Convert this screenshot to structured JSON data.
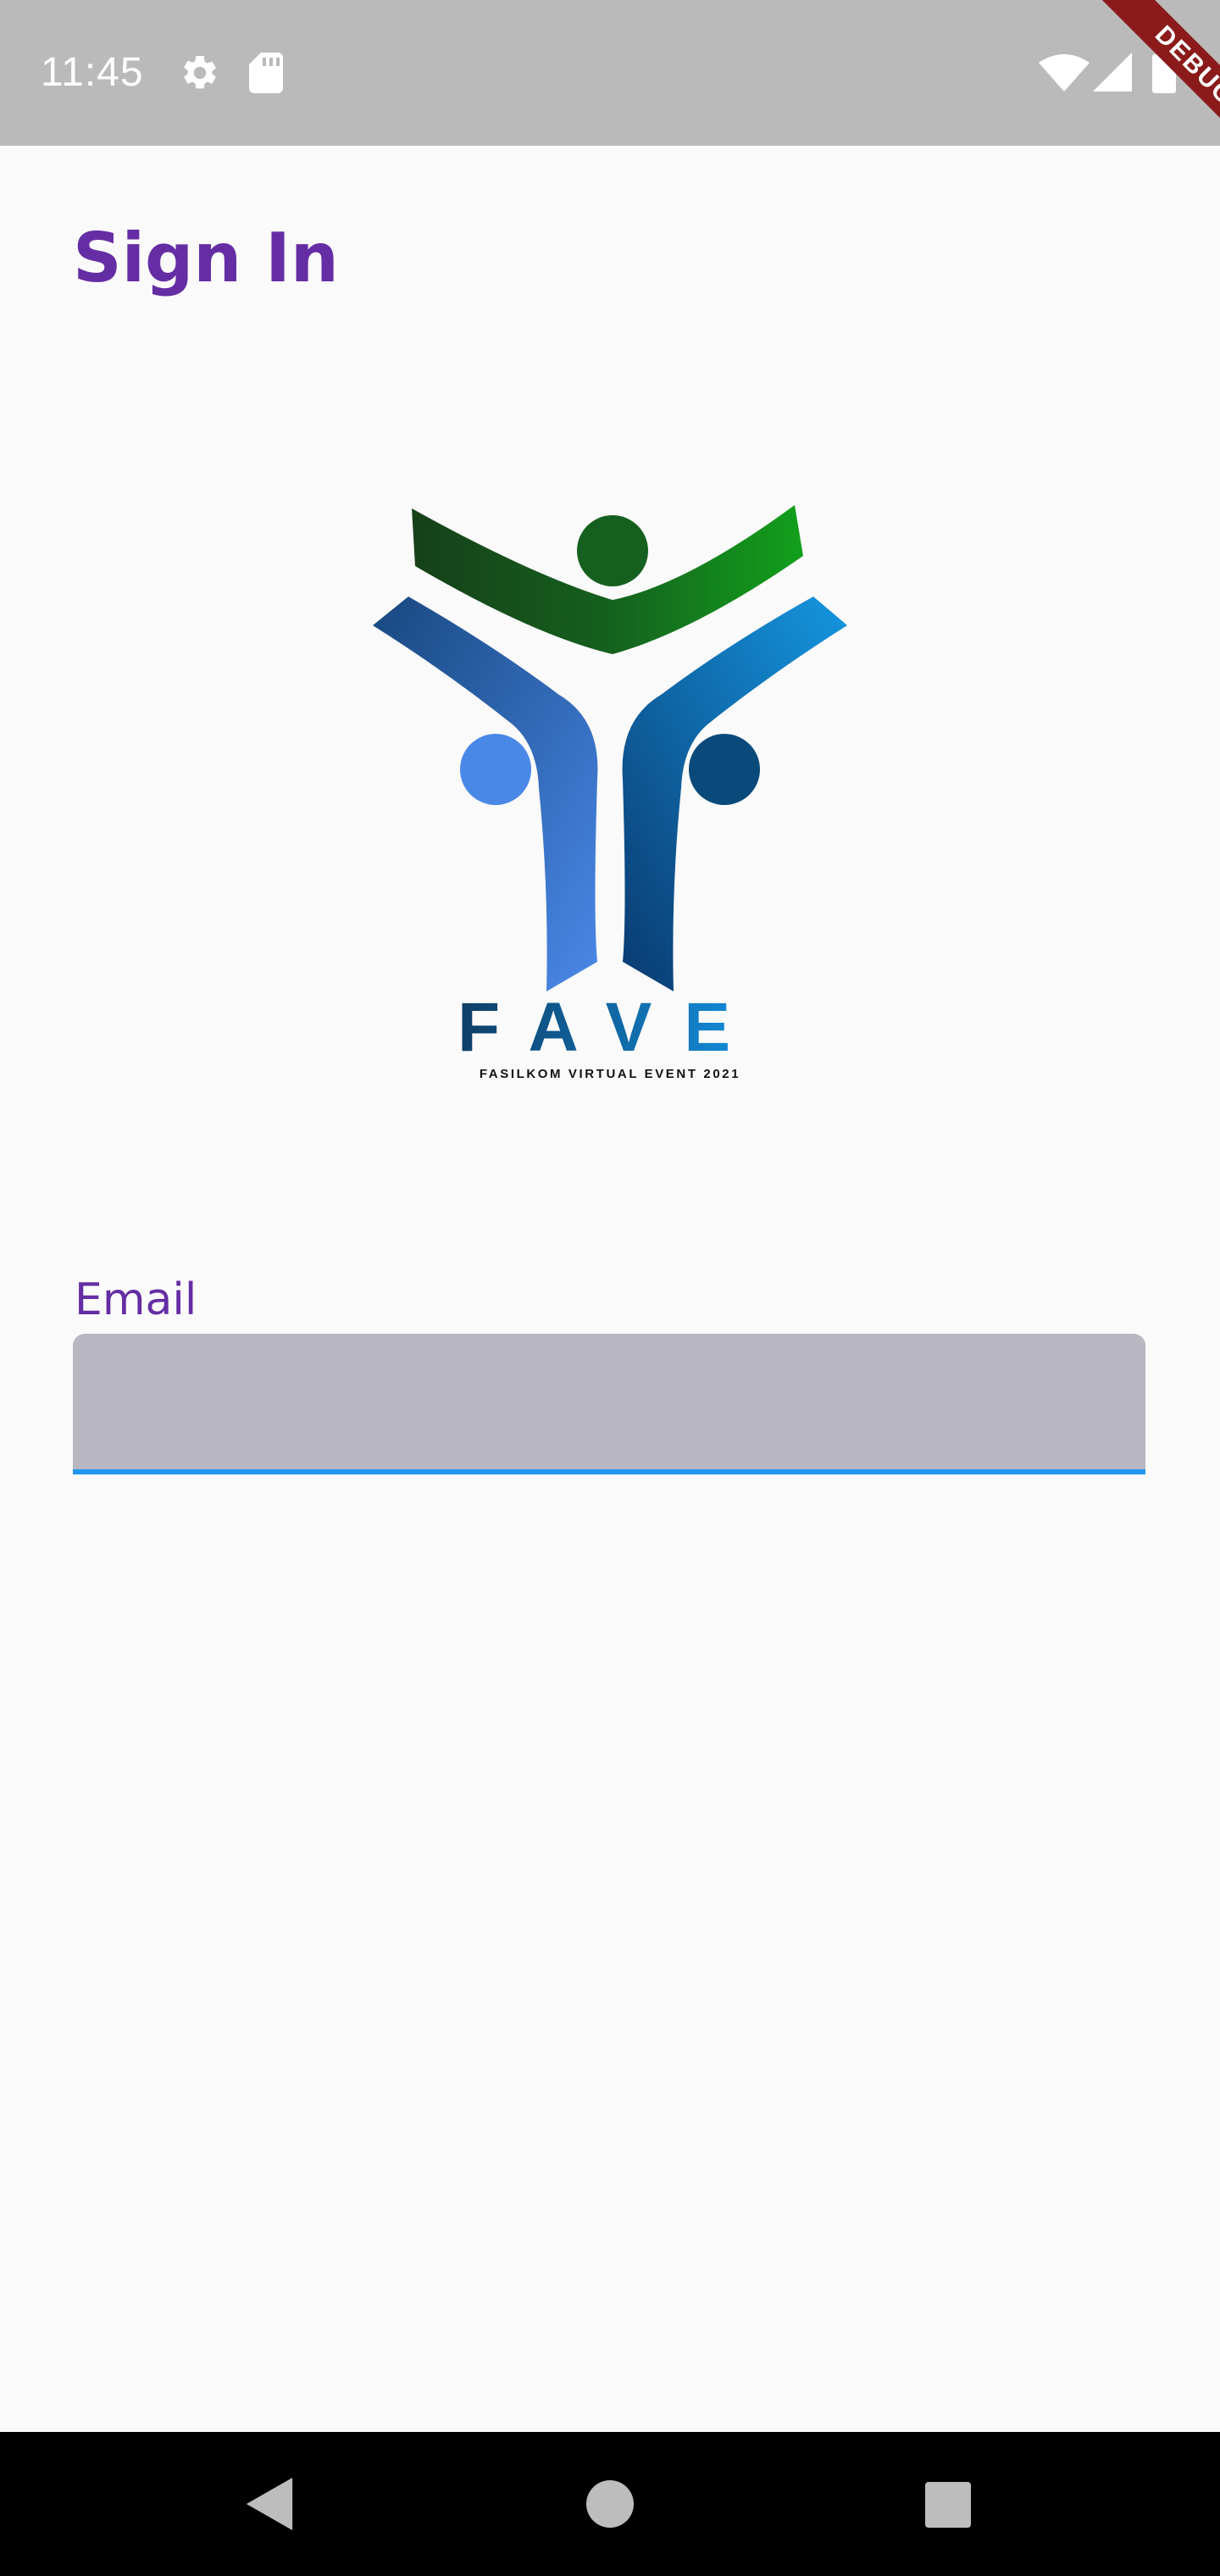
{
  "status_bar": {
    "time": "11:45",
    "icons": [
      "gear-icon",
      "sd-card-icon",
      "wifi-icon",
      "signal-icon",
      "battery-icon"
    ]
  },
  "debug_banner": {
    "label": "DEBUG"
  },
  "page": {
    "title": "Sign In"
  },
  "logo": {
    "name": "FAVE",
    "tagline": "FASILKOM VIRTUAL EVENT 2021"
  },
  "form": {
    "email_label": "Email",
    "email_value": "",
    "email_placeholder": ""
  },
  "nav_bar": {
    "icons": [
      "back-icon",
      "home-icon",
      "recents-icon"
    ]
  },
  "colors": {
    "accent": "#652DA4",
    "input_fill": "#B7B6C1",
    "input_underline": "#2196F3",
    "status_bar": "#BABABA",
    "background": "#FAFAFA",
    "debug_ribbon": "#8B1A1A"
  }
}
